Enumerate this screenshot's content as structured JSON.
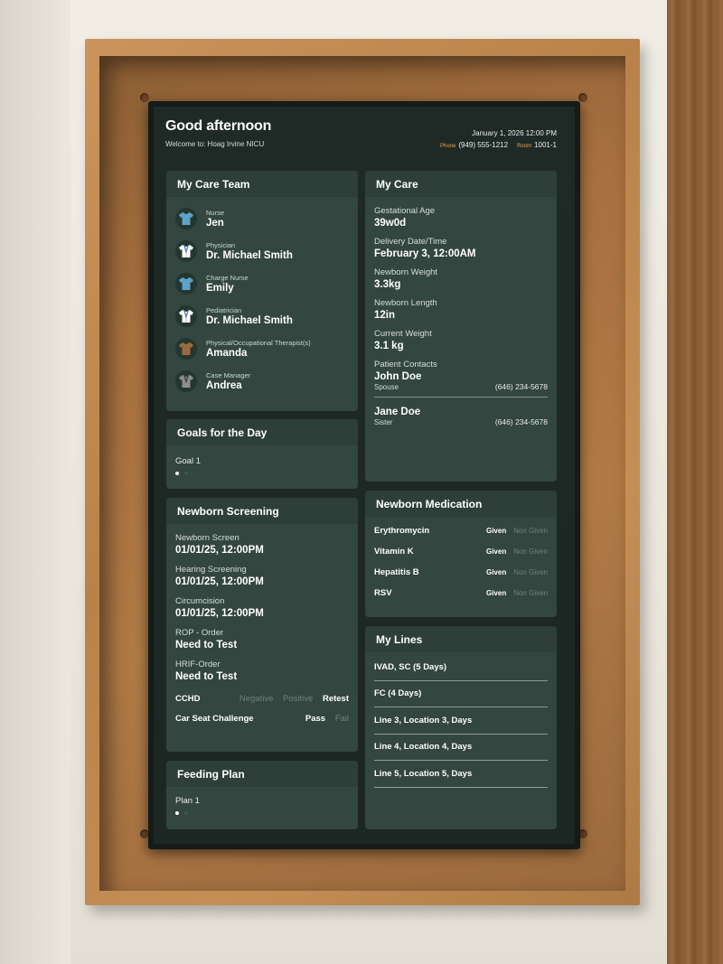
{
  "header": {
    "greeting": "Good afternoon",
    "welcome": "Welcome to: Hoag Irvine NICU",
    "datetime": "January 1, 2026  12:00 PM",
    "phone_label": "Phone",
    "phone": "(949) 555-1212",
    "room_label": "Room",
    "room": "1001-1"
  },
  "care_team": {
    "title": "My Care Team",
    "members": [
      {
        "role": "Nurse",
        "name": "Jen",
        "icon": "scrubs-icon",
        "color": "#5ea3c8"
      },
      {
        "role": "Physician",
        "name": "Dr. Michael Smith",
        "icon": "white-coat-icon",
        "color": "#ffffff"
      },
      {
        "role": "Charge Nurse",
        "name": "Emily",
        "icon": "scrubs-icon",
        "color": "#5ea3c8"
      },
      {
        "role": "Pediatrician",
        "name": "Dr. Michael Smith",
        "icon": "white-coat-icon",
        "color": "#ffffff"
      },
      {
        "role": "Physical/Occupational Therapist(s)",
        "name": "Amanda",
        "icon": "scrubs-icon",
        "color": "#9a6a3e"
      },
      {
        "role": "Case Manager",
        "name": "Andrea",
        "icon": "suit-icon",
        "color": "#8c8f8e"
      }
    ]
  },
  "goals": {
    "title": "Goals for the Day",
    "text": "Goal 1"
  },
  "screening": {
    "title": "Newborn Screening",
    "items": [
      {
        "label": "Newborn Screen",
        "value": "01/01/25, 12:00PM"
      },
      {
        "label": "Hearing Screening",
        "value": "01/01/25, 12:00PM"
      },
      {
        "label": "Circumcision",
        "value": "01/01/25, 12:00PM"
      },
      {
        "label": "ROP - Order",
        "value": "Need to Test"
      },
      {
        "label": "HRIF-Order",
        "value": "Need to Test"
      }
    ],
    "cchd": {
      "label": "CCHD",
      "opt1": "Negative",
      "opt2": "Positive",
      "opt3": "Retest"
    },
    "car_seat": {
      "label": "Car Seat Challenge",
      "opt1": "Pass",
      "opt2": "Fail"
    }
  },
  "feeding": {
    "title": "Feeding Plan",
    "text": "Plan 1"
  },
  "my_care": {
    "title": "My Care",
    "items": [
      {
        "label": "Gestational Age",
        "value": "39w0d"
      },
      {
        "label": "Delivery Date/Time",
        "value": "February 3, 12:00AM"
      },
      {
        "label": "Newborn Weight",
        "value": "3.3kg"
      },
      {
        "label": "Newborn Length",
        "value": "12in"
      },
      {
        "label": "Current Weight",
        "value": "3.1 kg"
      }
    ],
    "contacts_label": "Patient Contacts",
    "contacts": [
      {
        "name": "John Doe",
        "relation": "Spouse",
        "phone": "(646) 234-5678"
      },
      {
        "name": "Jane Doe",
        "relation": "Sister",
        "phone": "(646) 234-5678"
      }
    ]
  },
  "medication": {
    "title": "Newborn Medication",
    "given_label": "Given",
    "not_given_label": "Non Given",
    "items": [
      "Erythromycin",
      "Vitamin K",
      "Hepatitis B",
      "RSV"
    ]
  },
  "lines": {
    "title": "My Lines",
    "items": [
      "IVAD, SC (5 Days)",
      "FC (4 Days)",
      "Line 3, Location 3, Days",
      "Line 4, Location 4, Days",
      "Line 5, Location 5, Days"
    ]
  },
  "colors": {
    "accent": "#e8a24a",
    "card": "#33463f",
    "card_header": "#2d3f38",
    "background": "#1f2a26"
  }
}
